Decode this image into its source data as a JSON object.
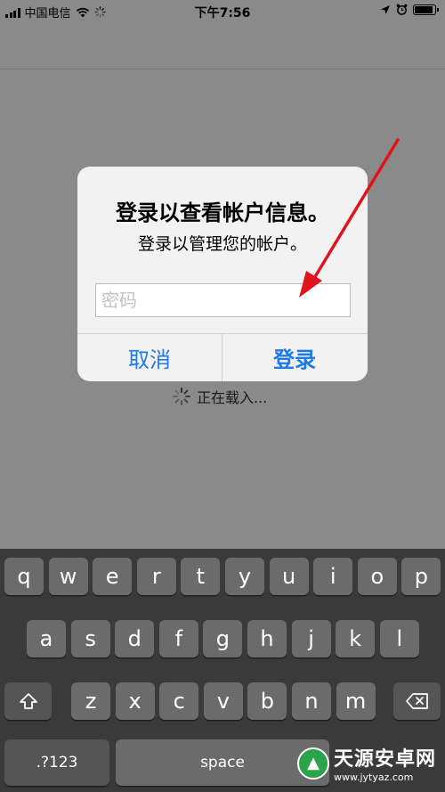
{
  "status_bar": {
    "carrier": "中国电信",
    "time": "下午7:56",
    "battery_level": 0.9
  },
  "dialog": {
    "title": "登录以查看帐户信息。",
    "message": "登录以管理您的帐户。",
    "password_placeholder": "密码",
    "cancel_label": "取消",
    "login_label": "登录"
  },
  "loading_text": "正在载入...",
  "keyboard": {
    "row1": [
      "q",
      "w",
      "e",
      "r",
      "t",
      "y",
      "u",
      "i",
      "o",
      "p"
    ],
    "row2": [
      "a",
      "s",
      "d",
      "f",
      "g",
      "h",
      "j",
      "k",
      "l"
    ],
    "row3": [
      "z",
      "x",
      "c",
      "v",
      "b",
      "n",
      "m"
    ],
    "numbers_label": ".?123",
    "space_label": "space"
  },
  "watermark": {
    "name": "天源安卓网",
    "url": "www.jytyaz.com"
  },
  "colors": {
    "accent": "#1d7ae8",
    "arrow": "#e0151b",
    "overlay_bg": "#8a8a8a",
    "keyboard_bg": "#3a3a3a"
  }
}
